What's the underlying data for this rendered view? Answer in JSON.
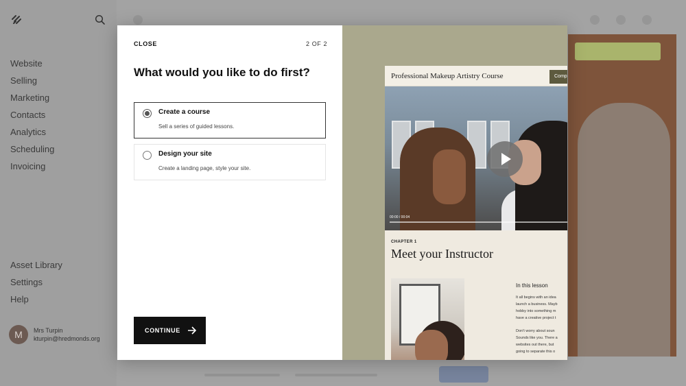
{
  "sidebar": {
    "nav_items": [
      "Website",
      "Selling",
      "Marketing",
      "Contacts",
      "Analytics",
      "Scheduling",
      "Invoicing"
    ],
    "bottom_items": [
      "Asset Library",
      "Settings",
      "Help"
    ],
    "user": {
      "initial": "M",
      "name": "Mrs Turpin",
      "email": "kturpin@hredmonds.org"
    }
  },
  "modal": {
    "close_label": "CLOSE",
    "step": "2 OF 2",
    "heading": "What would you like to do first?",
    "options": [
      {
        "title": "Create a course",
        "description": "Sell a series of guided lessons.",
        "selected": true
      },
      {
        "title": "Design your site",
        "description": "Create a landing page, style your site.",
        "selected": false
      }
    ],
    "continue_label": "CONTINUE"
  },
  "preview": {
    "site_title": "Professional Makeup Artistry Course",
    "header_button": "Comp",
    "video_time": "00:00 / 00:04",
    "chapter_label": "CHAPTER 1",
    "chapter_title": "Meet your Instructor",
    "lesson_heading": "In this lesson",
    "lesson_para1": [
      "It all begins with an idea",
      "launch a business. Mayb",
      "hobby into something m",
      "have a creative project t"
    ],
    "lesson_para2": [
      "Don’t worry about soun",
      "Sounds like you. There a",
      "websites out there, but",
      "going to separate this o"
    ]
  },
  "colors": {
    "overlay": "#a3a3a3",
    "modal_bg": "#ffffff",
    "button_bg": "#111111",
    "preview_panel": "#aaa88d",
    "preview_accent": "#5d5a3e"
  }
}
